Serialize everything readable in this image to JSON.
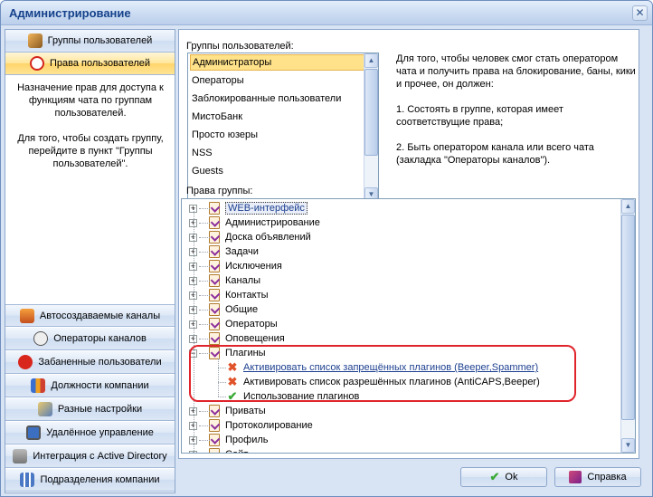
{
  "window": {
    "title": "Администрирование",
    "close_glyph": "✕"
  },
  "sidebar": {
    "top_items": [
      {
        "label": "Группы пользователей",
        "icon": "users-group-icon"
      },
      {
        "label": "Права пользователей",
        "icon": "no-entry-icon"
      }
    ],
    "description": [
      "Назначение прав для доступа к функциям чата по группам пользователей.",
      "Для того, чтобы создать группу, перейдите в пункт \"Группы пользователей\"."
    ],
    "bottom_items": [
      {
        "label": "Автосоздаваемые каналы",
        "icon": "gift-icon"
      },
      {
        "label": "Операторы каналов",
        "icon": "skull-icon"
      },
      {
        "label": "Забаненные пользователи",
        "icon": "warning-icon"
      },
      {
        "label": "Должности компании",
        "icon": "bar-chart-icon"
      },
      {
        "label": "Разные настройки",
        "icon": "settings-icon"
      },
      {
        "label": "Удалённое управление",
        "icon": "monitor-icon"
      },
      {
        "label": "Интеграция с Active Directory",
        "icon": "server-icon"
      },
      {
        "label": "Подразделения компании",
        "icon": "grid-icon"
      }
    ]
  },
  "groups": {
    "label": "Группы пользователей:",
    "items": [
      "Администраторы",
      "Операторы",
      "Заблокированные пользователи",
      "МистоБанк",
      "Просто юзеры",
      "NSS",
      "Guests"
    ],
    "selected_index": 0
  },
  "info": {
    "paragraphs": [
      "Для того, чтобы человек смог стать оператором чата и получить права на блокирование, баны, кики и прочее, он должен:",
      "1. Состоять в группе, которая имеет соответствущие права;",
      "2. Быть оператором канала или всего чата (закладка \"Операторы каналов\")."
    ]
  },
  "rights": {
    "label": "Права группы:",
    "nodes": [
      {
        "label": "WEB-интерфейс",
        "expander": "+",
        "state": "checked",
        "highlighted": true
      },
      {
        "label": "Администрирование",
        "expander": "+",
        "state": "checked"
      },
      {
        "label": "Доска объявлений",
        "expander": "+",
        "state": "checked"
      },
      {
        "label": "Задачи",
        "expander": "+",
        "state": "checked"
      },
      {
        "label": "Исключения",
        "expander": "+",
        "state": "checked"
      },
      {
        "label": "Каналы",
        "expander": "+",
        "state": "checked"
      },
      {
        "label": "Контакты",
        "expander": "+",
        "state": "checked"
      },
      {
        "label": "Общие",
        "expander": "+",
        "state": "checked"
      },
      {
        "label": "Операторы",
        "expander": "+",
        "state": "checked"
      },
      {
        "label": "Оповещения",
        "expander": "+",
        "state": "checked"
      },
      {
        "label": "Плагины",
        "expander": "−",
        "state": "checked"
      },
      {
        "label": "Активировать список запрещённых плагинов (Beeper,Spammer)",
        "child": true,
        "state": "denied",
        "link": true
      },
      {
        "label": "Активировать список разрешённых плагинов (AntiCAPS,Beeper)",
        "child": true,
        "state": "denied"
      },
      {
        "label": "Использование плагинов",
        "child": true,
        "state": "allowed"
      },
      {
        "label": "Приваты",
        "expander": "+",
        "state": "checked"
      },
      {
        "label": "Протоколирование",
        "expander": "+",
        "state": "checked"
      },
      {
        "label": "Профиль",
        "expander": "+",
        "state": "checked"
      },
      {
        "label": "Сайт",
        "expander": "+",
        "state": "checked"
      }
    ],
    "denied_glyph": "✖",
    "allowed_glyph": "✔"
  },
  "buttons": {
    "ok": {
      "label": "Ok",
      "icon": "checkmark-icon"
    },
    "help": {
      "label": "Справка",
      "icon": "help-book-icon"
    }
  },
  "colors": {
    "accent_selected": "#ffe28a",
    "highlight_ring": "#e0242b",
    "link": "#1c3f8f"
  }
}
